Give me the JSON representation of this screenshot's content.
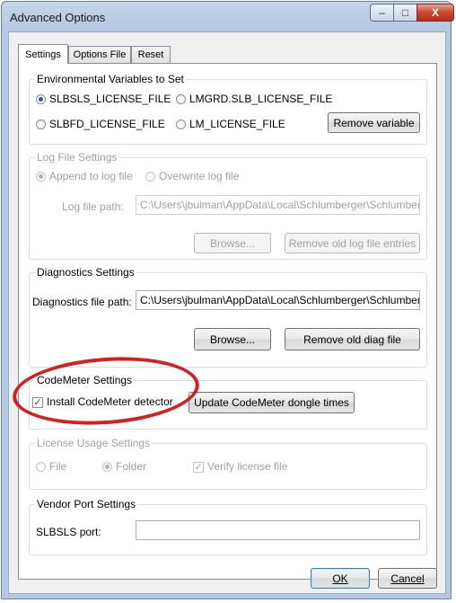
{
  "window": {
    "title": "Advanced Options",
    "controls": {
      "minimize": "–",
      "maximize": "□",
      "close": "X"
    }
  },
  "tabs": [
    "Settings",
    "Options File",
    "Reset"
  ],
  "env_vars": {
    "legend": "Environmental Variables to Set",
    "options": [
      "SLBSLS_LICENSE_FILE",
      "LMGRD.SLB_LICENSE_FILE",
      "SLBFD_LICENSE_FILE",
      "LM_LICENSE_FILE"
    ],
    "selected": "SLBSLS_LICENSE_FILE",
    "remove_button": "Remove variable"
  },
  "log": {
    "legend": "Log File Settings",
    "append": "Append to log file",
    "overwrite": "Overwrite log file",
    "path_label": "Log file path:",
    "path_value": "C:\\Users\\jbulman\\AppData\\Local\\Schlumberger\\Schlumberge",
    "browse": "Browse...",
    "remove": "Remove old log file entries"
  },
  "diag": {
    "legend": "Diagnostics Settings",
    "path_label": "Diagnostics file path:",
    "path_value": "C:\\Users\\jbulman\\AppData\\Local\\Schlumberger\\Schlumberge",
    "browse": "Browse...",
    "remove": "Remove old diag file"
  },
  "codemeter": {
    "legend": "CodeMeter Settings",
    "install_label": "Install CodeMeter detector",
    "install_checked": true,
    "update_button": "Update CodeMeter dongle times"
  },
  "usage": {
    "legend": "License Usage Settings",
    "file": "File",
    "folder": "Folder",
    "selected": "Folder",
    "verify": "Verify license file",
    "verify_checked": true
  },
  "vendor": {
    "legend": "Vendor Port Settings",
    "port_label": "SLBSLS port:",
    "port_value": ""
  },
  "footer": {
    "ok": "OK",
    "cancel": "Cancel"
  },
  "colors": {
    "highlight_ellipse": "#d62020",
    "title_bar": "#b3c8e3"
  }
}
